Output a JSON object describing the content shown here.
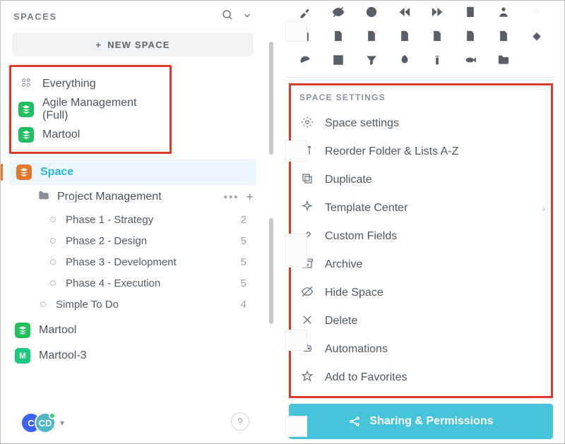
{
  "sidebar": {
    "title": "SPACES",
    "new_space": "NEW SPACE",
    "items_a": [
      {
        "label": "Everything"
      },
      {
        "label": "Agile Management (Full)"
      },
      {
        "label": "Martool"
      }
    ],
    "active_space": "Space",
    "folder": {
      "label": "Project Management"
    },
    "phases": [
      {
        "label": "Phase 1 - Strategy",
        "count": "2"
      },
      {
        "label": "Phase 2 - Design",
        "count": "5"
      },
      {
        "label": "Phase 3 - Development",
        "count": "5"
      },
      {
        "label": "Phase 4 - Execution",
        "count": "5"
      }
    ],
    "simple": {
      "label": "Simple To Do",
      "count": "4"
    },
    "extra": [
      {
        "label": "Martool"
      },
      {
        "label": "Martool-3"
      }
    ],
    "avatars": [
      "C",
      "CD"
    ]
  },
  "settings": {
    "section_title": "SPACE SETTINGS",
    "rows": [
      "Space settings",
      "Reorder Folder & Lists A-Z",
      "Duplicate",
      "Template Center",
      "Custom Fields",
      "Archive",
      "Hide Space",
      "Delete",
      "Automations",
      "Add to Favorites"
    ],
    "share_btn": "Sharing & Permissions"
  }
}
